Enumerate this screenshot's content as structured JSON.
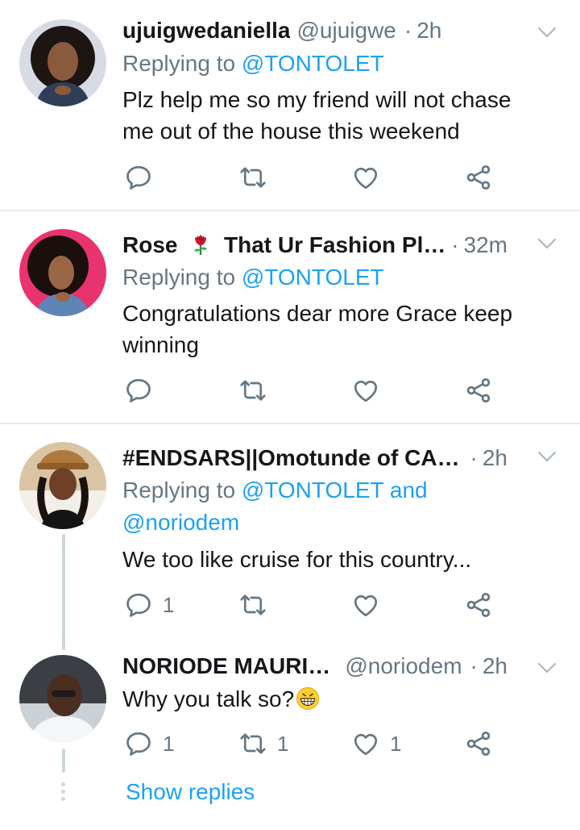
{
  "tweets": [
    {
      "name": "ujuigwedaniella",
      "handle": "@ujuigwe",
      "time": "2h",
      "reply_prefix": "Replying to",
      "reply_mentions": "@TONTOLET",
      "text_lines": [
        "Plz help me so my friend will not chase",
        "me out of the house this weekend"
      ],
      "counts": {
        "reply": "",
        "retweet": "",
        "like": ""
      }
    },
    {
      "name": "Rose 🌹 That Ur Fashion Plu...",
      "name_parts": {
        "before": "Rose",
        "emoji": "rose-emoji",
        "after": "That Ur Fashion Plu..."
      },
      "handle": "",
      "time": "32m",
      "reply_prefix": "Replying to",
      "reply_mentions": "@TONTOLET",
      "text_lines": [
        "Congratulations dear more Grace keep",
        "winning"
      ],
      "counts": {
        "reply": "",
        "retweet": "",
        "like": ""
      }
    },
    {
      "name": "#ENDSARS||Omotunde of CAN...",
      "handle": "",
      "time": "2h",
      "reply_prefix": "Replying to",
      "reply_mentions": "@TONTOLET and",
      "reply_mentions_line2": "@noriodem",
      "text_lines": [
        "We too like cruise for this country..."
      ],
      "counts": {
        "reply": "1",
        "retweet": "",
        "like": ""
      }
    },
    {
      "name": "NORIODE MAURICE",
      "handle": "@noriodem",
      "time": "2h",
      "text": "Why you talk so?",
      "text_emoji": "grinning-face-emoji",
      "counts": {
        "reply": "1",
        "retweet": "1",
        "like": "1"
      }
    }
  ],
  "show_replies": "Show replies",
  "separator": "·",
  "colors": {
    "link": "#1da1f2",
    "secondary": "#657786",
    "divider": "#e6ecf0",
    "thread_line": "#ccd6dd"
  },
  "icons": [
    "reply-icon",
    "retweet-icon",
    "like-icon",
    "share-icon",
    "chevron-down-icon"
  ]
}
